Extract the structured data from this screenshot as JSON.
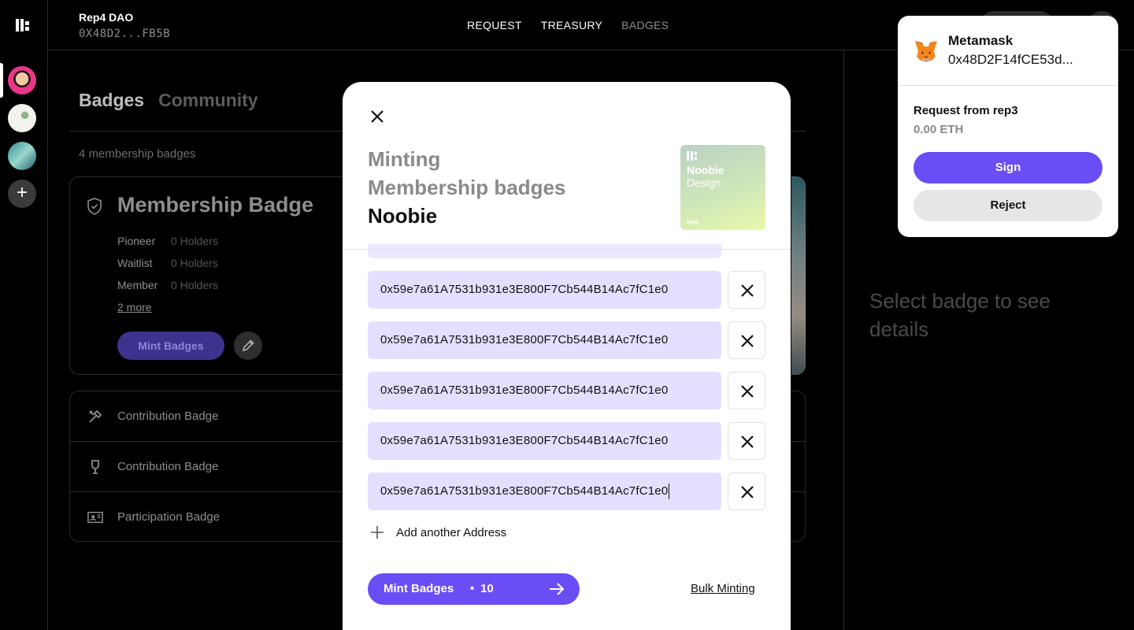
{
  "dao": {
    "name": "Rep4 DAO",
    "address": "0X48D2...FB5B"
  },
  "nav": {
    "items": [
      "REQUEST",
      "TREASURY",
      "BADGES"
    ]
  },
  "tabs": {
    "badges": "Badges",
    "community": "Community"
  },
  "badges_count": "4 membership badges",
  "membership_card": {
    "title": "Membership Badge",
    "tiers": [
      {
        "name": "Pioneer",
        "holders": "0 Holders"
      },
      {
        "name": "Waitlist",
        "holders": "0 Holders"
      },
      {
        "name": "Member",
        "holders": "0 Holders"
      }
    ],
    "more_link": "2 more",
    "mint_button": "Mint Badges"
  },
  "badge_list": [
    {
      "label": "Contribution Badge",
      "icon": "tools-icon"
    },
    {
      "label": "Contribution Badge",
      "icon": "trophy-icon"
    },
    {
      "label": "Participation Badge",
      "icon": "id-card-icon"
    }
  ],
  "right_panel": {
    "hint": "Select badge to see details"
  },
  "modal": {
    "title_line1": "Minting",
    "title_line2": "Membership badges",
    "title_line3": "Noobie",
    "thumbnail": {
      "line1": "Noobie",
      "line2": "Design",
      "footer": "Rep3"
    },
    "addresses": [
      "0x59e7a61A7531b931e3E800F7Cb544B14Ac7fC1e0",
      "0x59e7a61A7531b931e3E800F7Cb544B14Ac7fC1e0",
      "0x59e7a61A7531b931e3E800F7Cb544B14Ac7fC1e0",
      "0x59e7a61A7531b931e3E800F7Cb544B14Ac7fC1e0",
      "0x59e7a61A7531b931e3E800F7Cb544B14Ac7fC1e0"
    ],
    "add_address": "Add another Address",
    "mint_button": {
      "label": "Mint Badges",
      "separator": "•",
      "count": "10"
    },
    "bulk_minting": "Bulk Minting"
  },
  "metamask": {
    "name": "Metamask",
    "address": "0x48D2F14fCE53d...",
    "request": "Request from rep3",
    "amount": "0.00 ETH",
    "sign": "Sign",
    "reject": "Reject"
  },
  "colors": {
    "accent": "#6a4df5",
    "input_bg": "#e3e0ff",
    "background": "#000000"
  }
}
